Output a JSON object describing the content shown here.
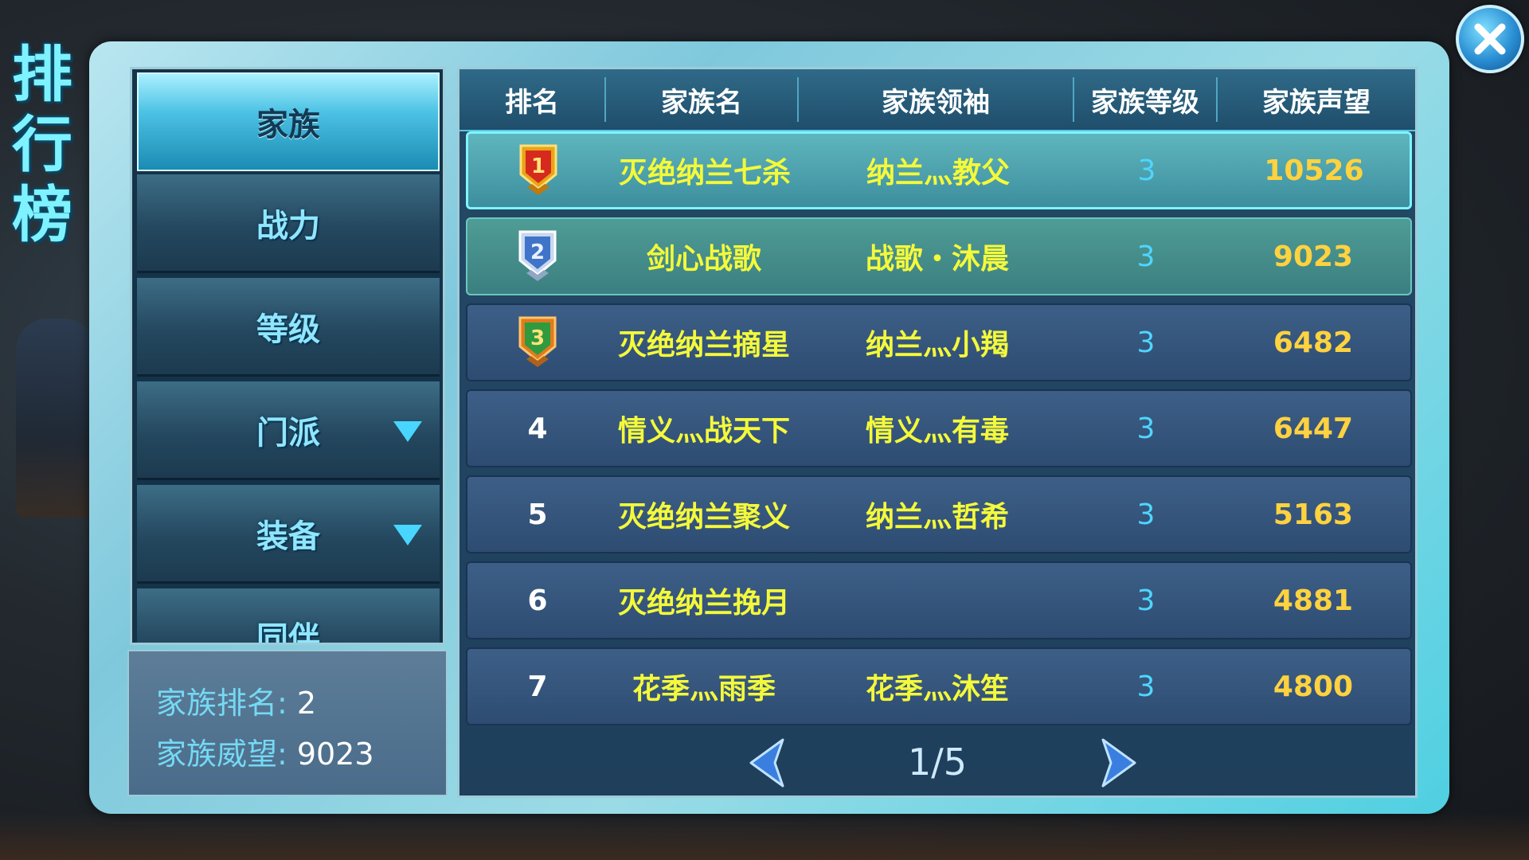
{
  "page_title": "排行榜",
  "menu": {
    "items": [
      {
        "label": "家族",
        "active": true,
        "dropdown": false
      },
      {
        "label": "战力",
        "active": false,
        "dropdown": false
      },
      {
        "label": "等级",
        "active": false,
        "dropdown": false
      },
      {
        "label": "门派",
        "active": false,
        "dropdown": true
      },
      {
        "label": "装备",
        "active": false,
        "dropdown": true
      },
      {
        "label": "同伴",
        "active": false,
        "dropdown": false
      }
    ]
  },
  "stats": {
    "rank_label": "家族排名:",
    "rank_value": "2",
    "prestige_label": "家族威望:",
    "prestige_value": "9023"
  },
  "table": {
    "headers": [
      "排名",
      "家族名",
      "家族领袖",
      "家族等级",
      "家族声望"
    ],
    "rows": [
      {
        "rank": "1",
        "name": "灭绝纳兰七杀",
        "leader": "纳兰灬教父",
        "level": "3",
        "prestige": "10526"
      },
      {
        "rank": "2",
        "name": "剑心战歌",
        "leader": "战歌・沐晨",
        "level": "3",
        "prestige": "9023"
      },
      {
        "rank": "3",
        "name": "灭绝纳兰摘星",
        "leader": "纳兰灬小羯",
        "level": "3",
        "prestige": "6482"
      },
      {
        "rank": "4",
        "name": "情义灬战天下",
        "leader": "情义灬有毒",
        "level": "3",
        "prestige": "6447"
      },
      {
        "rank": "5",
        "name": "灭绝纳兰聚义",
        "leader": "纳兰灬哲希",
        "level": "3",
        "prestige": "5163"
      },
      {
        "rank": "6",
        "name": "灭绝纳兰挽月",
        "leader": "",
        "level": "3",
        "prestige": "4881"
      },
      {
        "rank": "7",
        "name": "花季灬雨季",
        "leader": "花季灬沐笙",
        "level": "3",
        "prestige": "4800"
      }
    ]
  },
  "pager": {
    "text": "1/5"
  },
  "colors": {
    "accent": "#4fd0e2",
    "name_yellow": "#f4f93a",
    "prestige_gold": "#ffd23f",
    "level_blue": "#4fd6ff",
    "badge_gold": "#f2b81c",
    "badge_silver": "#8fb0d8",
    "badge_bronze": "#e07b1e"
  },
  "icons": {
    "close": "close-icon",
    "prev": "arrow-left-icon",
    "next": "arrow-right-icon",
    "dropdown": "triangle-down-icon",
    "rank_badges": [
      "gold-shield-icon",
      "silver-shield-icon",
      "green-shield-icon"
    ]
  }
}
